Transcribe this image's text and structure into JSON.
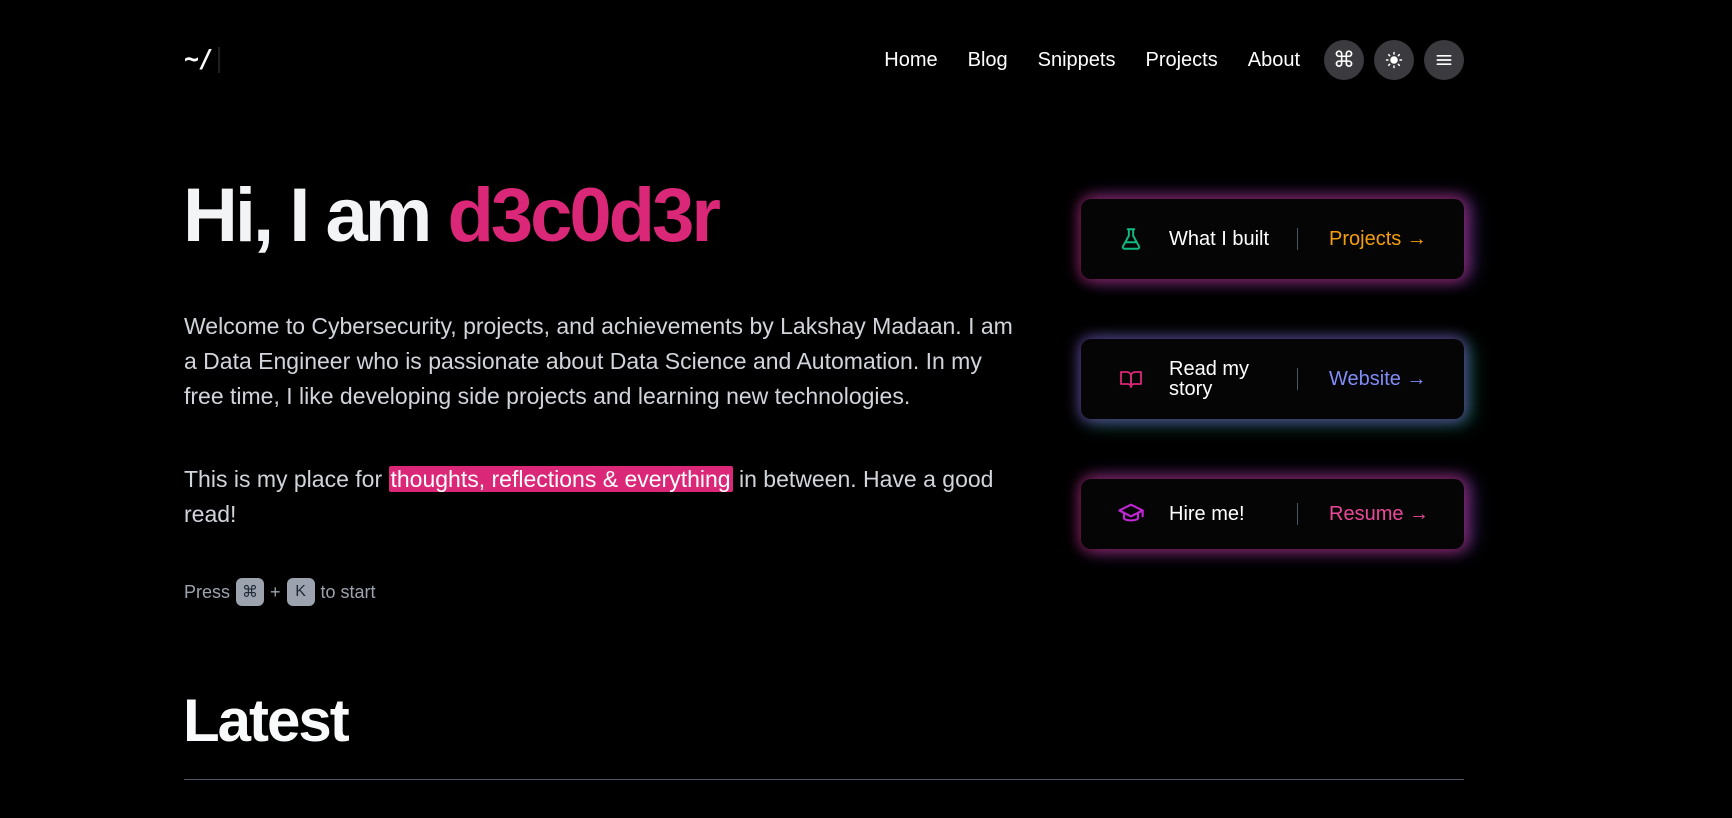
{
  "header": {
    "logo": "~/",
    "nav": [
      "Home",
      "Blog",
      "Snippets",
      "Projects",
      "About"
    ],
    "buttons": {
      "command": "⌘",
      "theme": "☀",
      "menu": "≡"
    }
  },
  "hero": {
    "greeting": "Hi, I am",
    "name": "d3c0d3r",
    "intro": "Welcome to Cybersecurity, projects, and achievements by Lakshay Madaan. I am a Data Engineer who is passionate about Data Science and Automation. In my free time, I like developing side projects and learning new technologies.",
    "place_prefix": "This is my place for",
    "place_highlight": "thoughts, reflections & everything",
    "place_suffix": "in between. Have a good read!",
    "press": "Press",
    "key1": "⌘",
    "plus": "+",
    "key2": "K",
    "press_suffix": "to start"
  },
  "cards": [
    {
      "label": "What I built",
      "cta": "Projects →",
      "cta_color": "#f59e0b",
      "icon_color": "#10b981",
      "icon": "flask-icon"
    },
    {
      "label": "Read my story",
      "cta": "Website →",
      "cta_color": "#818cf8",
      "icon_color": "#db2777",
      "icon": "book-icon"
    },
    {
      "label": "Hire me!",
      "cta": "Resume →",
      "cta_color": "#ec4899",
      "icon_color": "#c026d3",
      "icon": "graduation-cap-icon"
    }
  ],
  "latest": {
    "title": "Latest"
  },
  "colors": {
    "accent": "#db2777",
    "background": "#000000"
  }
}
